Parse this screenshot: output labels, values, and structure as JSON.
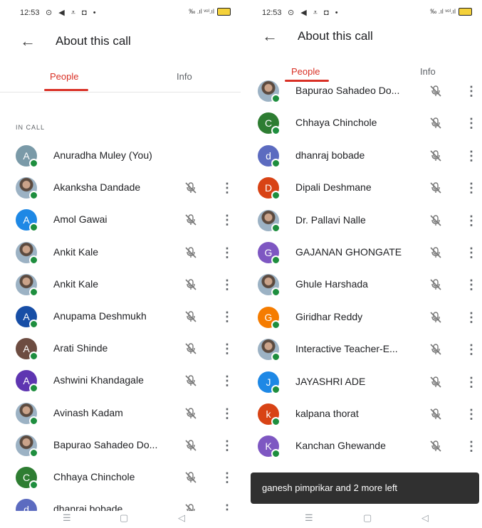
{
  "status": {
    "time": "12:53",
    "icons": "⊙ ◀ ⩡ ◘ •",
    "right": "‰ .ıl ᵛᵒˡ.ıl"
  },
  "header": {
    "title": "About this call"
  },
  "tabs": [
    {
      "label": "People"
    },
    {
      "label": "Info"
    }
  ],
  "section": {
    "label": "IN CALL"
  },
  "left_participants": [
    {
      "name": "Anuradha Muley (You)",
      "initial": "A",
      "color": "#7a9aa8",
      "photo": false,
      "you": true
    },
    {
      "name": "Akanksha Dandade",
      "initial": "",
      "color": "#555555",
      "photo": true
    },
    {
      "name": "Amol Gawai",
      "initial": "A",
      "color": "#1e88e5",
      "photo": false
    },
    {
      "name": "Ankit Kale",
      "initial": "",
      "color": "#555555",
      "photo": true
    },
    {
      "name": "Ankit Kale",
      "initial": "",
      "color": "#555555",
      "photo": true
    },
    {
      "name": "Anupama Deshmukh",
      "initial": "A",
      "color": "#174ea6",
      "photo": false
    },
    {
      "name": "Arati Shinde",
      "initial": "A",
      "color": "#6d4c41",
      "photo": false
    },
    {
      "name": "Ashwini Khandagale",
      "initial": "A",
      "color": "#5e35b1",
      "photo": false
    },
    {
      "name": "Avinash Kadam",
      "initial": "",
      "color": "#555555",
      "photo": true
    },
    {
      "name": "Bapurao Sahadeo Do...",
      "initial": "",
      "color": "#555555",
      "photo": true
    },
    {
      "name": "Chhaya Chinchole",
      "initial": "C",
      "color": "#2e7d32",
      "photo": false
    },
    {
      "name": "dhanraj bobade",
      "initial": "d",
      "color": "#5c6bc0",
      "photo": false
    }
  ],
  "right_participants": [
    {
      "name": "Bapurao Sahadeo Do...",
      "initial": "",
      "color": "#555555",
      "photo": true
    },
    {
      "name": "Chhaya Chinchole",
      "initial": "C",
      "color": "#2e7d32",
      "photo": false
    },
    {
      "name": "dhanraj bobade",
      "initial": "d",
      "color": "#5c6bc0",
      "photo": false
    },
    {
      "name": "Dipali Deshmane",
      "initial": "D",
      "color": "#d84315",
      "photo": false
    },
    {
      "name": "Dr. Pallavi Nalle",
      "initial": "",
      "color": "#555555",
      "photo": true
    },
    {
      "name": "GAJANAN GHONGATE",
      "initial": "G",
      "color": "#7e57c2",
      "photo": false
    },
    {
      "name": "Ghule Harshada",
      "initial": "",
      "color": "#555555",
      "photo": true
    },
    {
      "name": "Giridhar Reddy",
      "initial": "G",
      "color": "#f57c00",
      "photo": false
    },
    {
      "name": "Interactive Teacher-E...",
      "initial": "",
      "color": "#555555",
      "photo": true
    },
    {
      "name": "JAYASHRI ADE",
      "initial": "J",
      "color": "#1e88e5",
      "photo": false
    },
    {
      "name": "kalpana thorat",
      "initial": "k",
      "color": "#d84315",
      "photo": false
    },
    {
      "name": "Kanchan Ghewande",
      "initial": "K",
      "color": "#7e57c2",
      "photo": false
    }
  ],
  "toast": {
    "text": "ganesh pimprikar and 2 more left"
  },
  "navbar": {
    "items": [
      "☰",
      "▢",
      "◁"
    ]
  }
}
